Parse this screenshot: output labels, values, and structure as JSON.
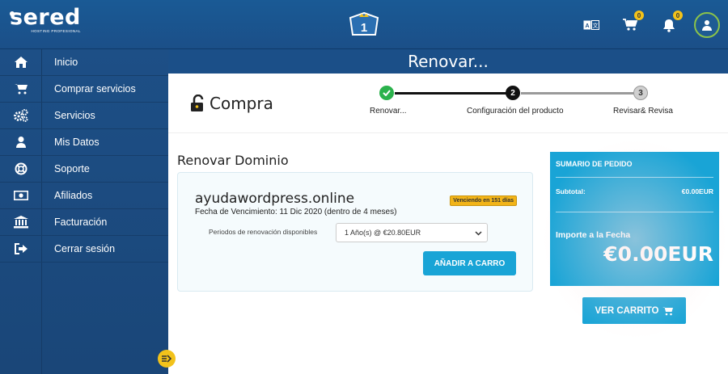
{
  "brand": {
    "name": "sered",
    "tagline": "HOSTING PROFESIONAL"
  },
  "header": {
    "center_badge_number": "1",
    "cart_count": "0",
    "notifications_count": "0"
  },
  "sidebar": {
    "items": [
      {
        "label": "Inicio",
        "icon": "home-icon"
      },
      {
        "label": "Comprar servicios",
        "icon": "cart-icon"
      },
      {
        "label": "Servicios",
        "icon": "gears-icon"
      },
      {
        "label": "Mis Datos",
        "icon": "user-icon"
      },
      {
        "label": "Soporte",
        "icon": "lifebuoy-icon"
      },
      {
        "label": "Afiliados",
        "icon": "money-icon"
      },
      {
        "label": "Facturación",
        "icon": "bank-icon"
      },
      {
        "label": "Cerrar sesión",
        "icon": "sign-out-icon"
      }
    ]
  },
  "page": {
    "title": "Renovar..."
  },
  "purchase": {
    "title": "Compra",
    "steps": [
      {
        "label": "Renovar...",
        "number": "✓",
        "state": "done"
      },
      {
        "label": "Configuración del producto",
        "number": "2",
        "state": "current"
      },
      {
        "label": "Revisar& Revisa",
        "number": "3",
        "state": "pending"
      }
    ]
  },
  "renew": {
    "section_title": "Renovar Dominio",
    "domain": "ayudawordpress.online",
    "expiry": "Fecha de Vencimiento: 11 Dic 2020 (dentro de 4 meses)",
    "warning_badge": "Venciendo en 151 días",
    "period_label": "Periodos de renovación disponibles",
    "period_selected": "1 Año(s) @ €20.80EUR",
    "add_to_cart": "AÑADIR A CARRO"
  },
  "summary": {
    "heading": "SUMARIO DE PEDIDO",
    "subtotal_label": "Subtotal:",
    "subtotal_value": "€0.00EUR",
    "due_today_label": "Importe a la Fecha",
    "due_today_value": "€0.00EUR"
  },
  "view_cart": "VER CARRITO",
  "colors": {
    "primary": "#1b4f88",
    "accent": "#19a4d6",
    "success": "#2bb24c",
    "badge": "#f2c21a"
  }
}
